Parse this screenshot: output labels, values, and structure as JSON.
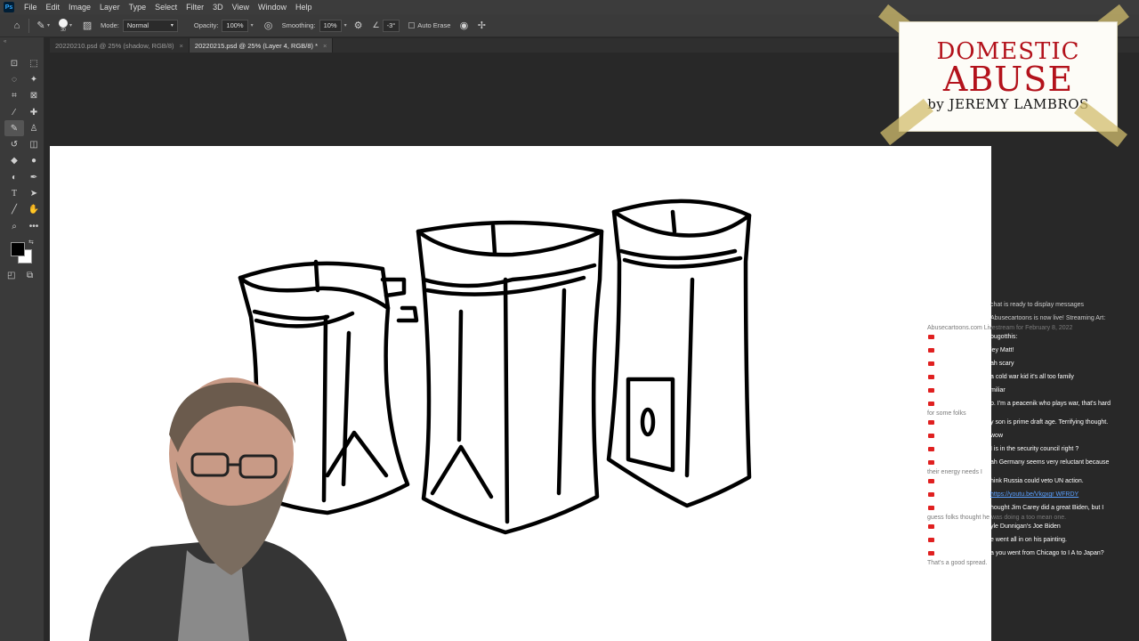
{
  "app": {
    "name": "Ps"
  },
  "menu": [
    "File",
    "Edit",
    "Image",
    "Layer",
    "Type",
    "Select",
    "Filter",
    "3D",
    "View",
    "Window",
    "Help"
  ],
  "options": {
    "brush_size": "30",
    "mode_label": "Mode:",
    "mode_value": "Normal",
    "opacity_label": "Opacity:",
    "opacity_value": "100%",
    "smoothing_label": "Smoothing:",
    "smoothing_value": "10%",
    "angle_value": "-3°",
    "auto_erase_label": "Auto Erase"
  },
  "tabs": [
    {
      "label": "20220210.psd @ 25% (shadow, RGB/8)",
      "active": false
    },
    {
      "label": "20220215.psd @ 25% (Layer 4, RGB/8) *",
      "active": true
    }
  ],
  "logo": {
    "line1": "DOMESTIC",
    "line2": "ABUSE",
    "line3": "by JEREMY LAMBROS"
  },
  "chat": [
    {
      "text": "chat is ready to display messages",
      "kind": "sys"
    },
    {
      "text": "Abusecartoons is now live! Streaming Art:",
      "cont": "Abusecartoons.com Livestream for February 8, 2022",
      "kind": "sys"
    },
    {
      "text": "bugotthis:"
    },
    {
      "text": "ley Matt!"
    },
    {
      "text": "ah scary"
    },
    {
      "text": "a cold war kid it's all too family"
    },
    {
      "text": "miliar"
    },
    {
      "text": "p. I'm a peacenik who plays war, that's hard",
      "cont": "for some folks"
    },
    {
      "text": "y son is prime draft age. Terrifying thought."
    },
    {
      "text": "wow"
    },
    {
      "text": "I is in the security council right ?"
    },
    {
      "text": "ah Germany seems very reluctant because",
      "cont": "their energy needs I"
    },
    {
      "text": "hink Russia could veto UN action."
    },
    {
      "text": "https://youtu.be/Vkgxgr WFRDY",
      "kind": "link"
    },
    {
      "text": "hought Jim Carey did a great Biden, but I",
      "cont": "guess folks thought he was doing a too mean one."
    },
    {
      "text": "yle Dunnigan's Joe Biden"
    },
    {
      "text": "e went all in on his painting."
    },
    {
      "text": "a you went from Chicago to I A to Japan?",
      "cont": "That's a good spread."
    }
  ]
}
